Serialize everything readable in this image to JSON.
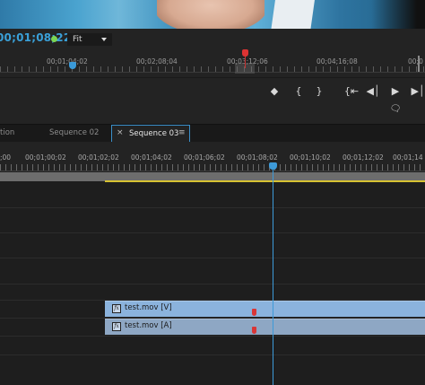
{
  "monitor": {
    "timecode": "00;01;08;22",
    "fit_label": "Fit",
    "ruler_labels": [
      "00;01;04;02",
      "00;02;08;04",
      "00;03;12;06",
      "00;04;16;08",
      "00;0"
    ]
  },
  "transport": {
    "marker": "◆",
    "mark_in": "{",
    "mark_out": "}",
    "go_to_in": "{⇤",
    "step_back": "◀│",
    "play": "▶",
    "step_forward": "▶│",
    "comment": "🗨"
  },
  "timeline": {
    "tabs": [
      {
        "label": "tion"
      },
      {
        "label": "Sequence 02"
      },
      {
        "label": "Sequence 03"
      }
    ],
    "tab_close": "×",
    "tab_menu": "≡",
    "ruler_labels": [
      ";00",
      "00;01;00;02",
      "00;01;02;02",
      "00;01;04;02",
      "00;01;06;02",
      "00;01;08;02",
      "00;01;10;02",
      "00;01;12;02",
      "00;01;14"
    ],
    "clips": {
      "video": {
        "name": "test.mov [V]",
        "fx": "fx"
      },
      "audio": {
        "name": "test.mov [A]",
        "fx": "fx"
      }
    }
  },
  "colors": {
    "timecode": "#3aa0d8",
    "playhead": "#3d9ad8",
    "video_clip": "#8bb3dd",
    "audio_clip": "#8ea7c4",
    "work_area_bar": "#d6c232",
    "marker": "#d93636",
    "status_dot": "#7cd651"
  }
}
